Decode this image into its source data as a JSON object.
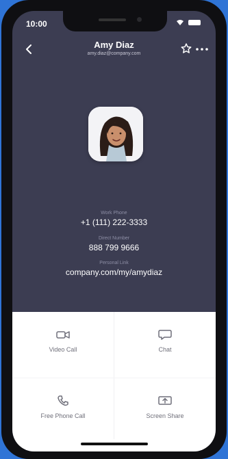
{
  "status": {
    "time": "10:00"
  },
  "header": {
    "name": "Amy Diaz",
    "email": "amy.diaz@company.com"
  },
  "profile": {
    "work_phone_label": "Work Phone",
    "work_phone_value": "+1 (111) 222-3333",
    "extension_label": "Direct Number",
    "extension_value": "888 799 9666",
    "personal_link_label": "Personal Link",
    "personal_link_value": "company.com/my/amydiaz"
  },
  "actions": {
    "video_call": "Video Call",
    "chat": "Chat",
    "phone_call": "Free Phone Call",
    "screen_share": "Screen Share"
  },
  "colors": {
    "background": "#2f74d6",
    "screen": "#3c3d52",
    "panel": "#ffffff",
    "icon_tint": "#6f6f7a"
  }
}
